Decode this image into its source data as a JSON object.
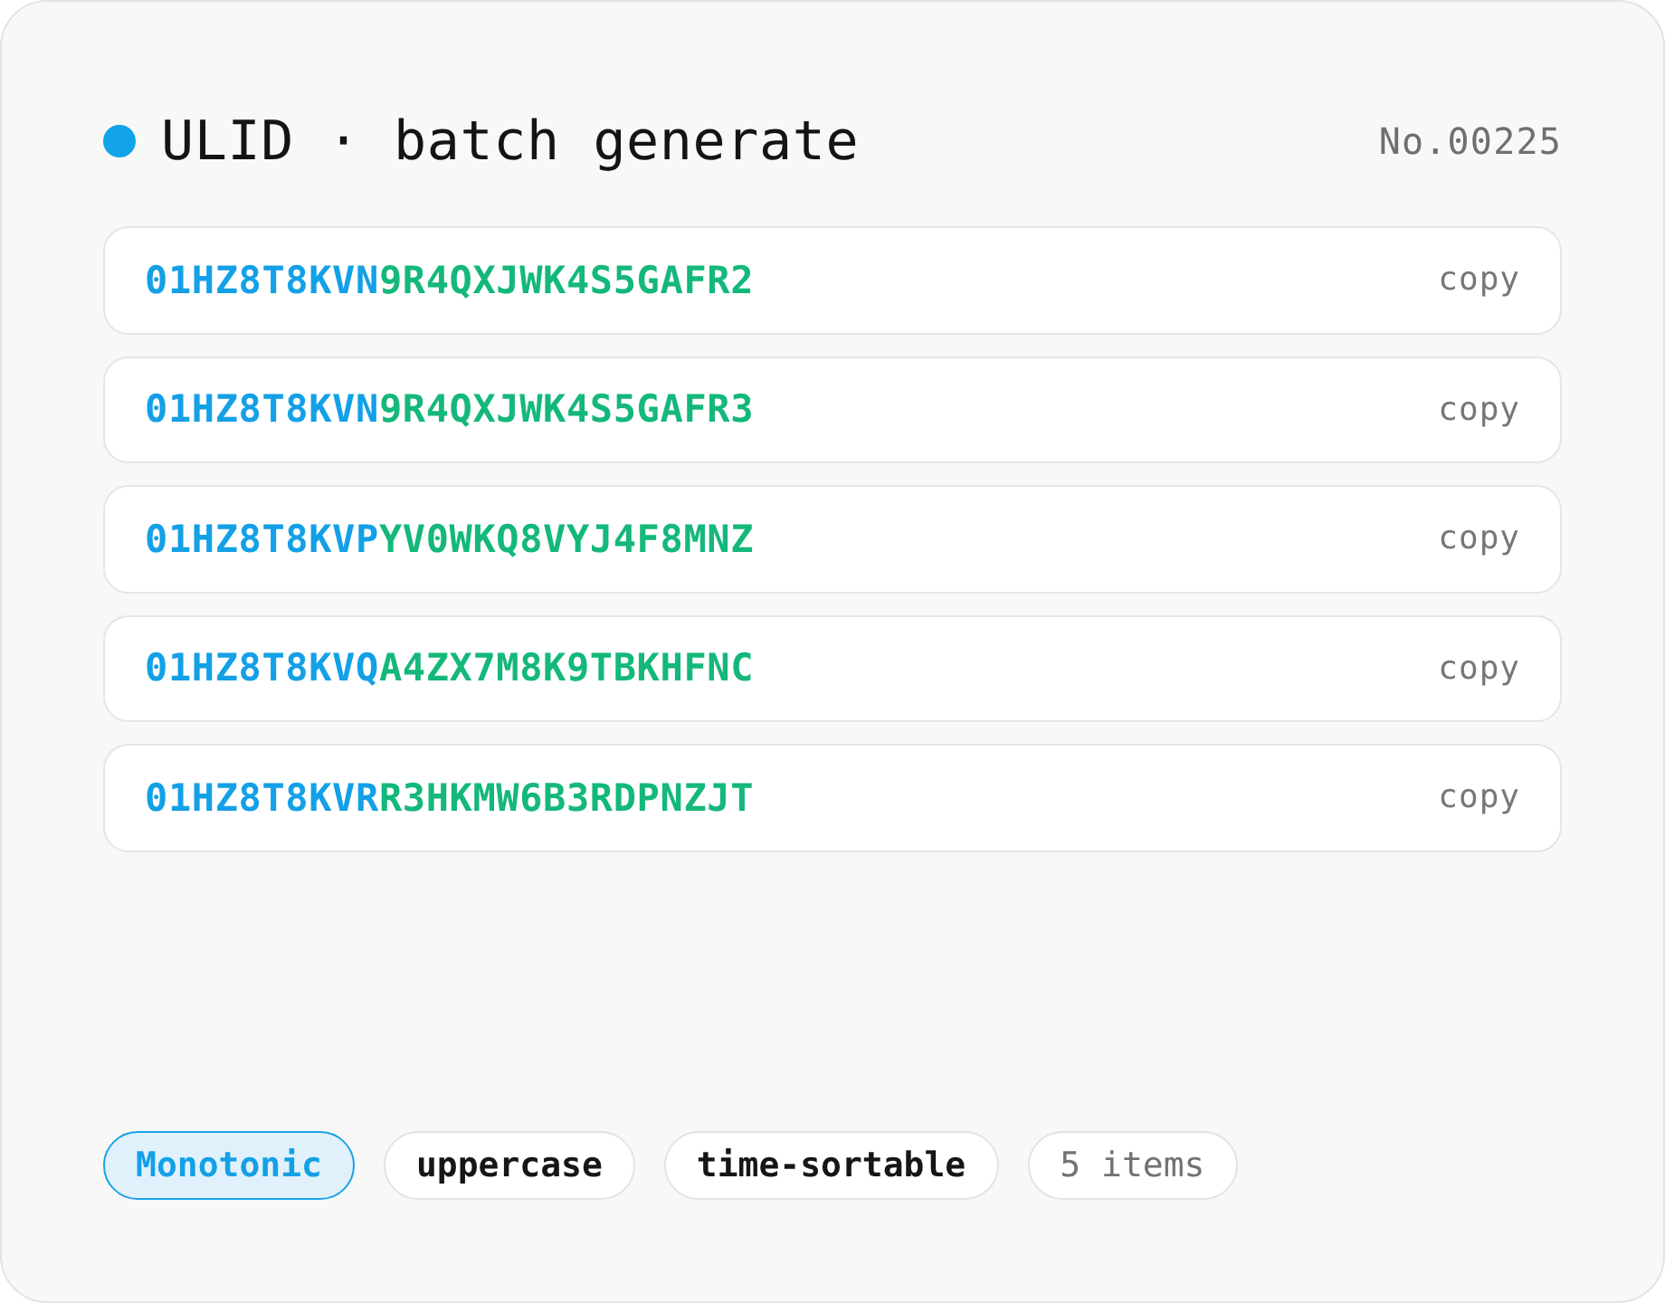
{
  "header": {
    "title": "ULID · batch generate",
    "number": "No.00225"
  },
  "ulids": [
    {
      "time": "01HZ8T8KVN",
      "random": "9R4QXJWK4S5GAFR2",
      "action": "copy"
    },
    {
      "time": "01HZ8T8KVN",
      "random": "9R4QXJWK4S5GAFR3",
      "action": "copy"
    },
    {
      "time": "01HZ8T8KVP",
      "random": "YV0WKQ8VYJ4F8MNZ",
      "action": "copy"
    },
    {
      "time": "01HZ8T8KVQ",
      "random": "A4ZX7M8K9TBKHFNC",
      "action": "copy"
    },
    {
      "time": "01HZ8T8KVR",
      "random": "R3HKMW6B3RDPNZJT",
      "action": "copy"
    }
  ],
  "options": [
    {
      "label": "Monotonic",
      "selected": true
    },
    {
      "label": "uppercase",
      "selected": false
    },
    {
      "label": "time-sortable",
      "selected": false
    }
  ],
  "count": "5 items"
}
